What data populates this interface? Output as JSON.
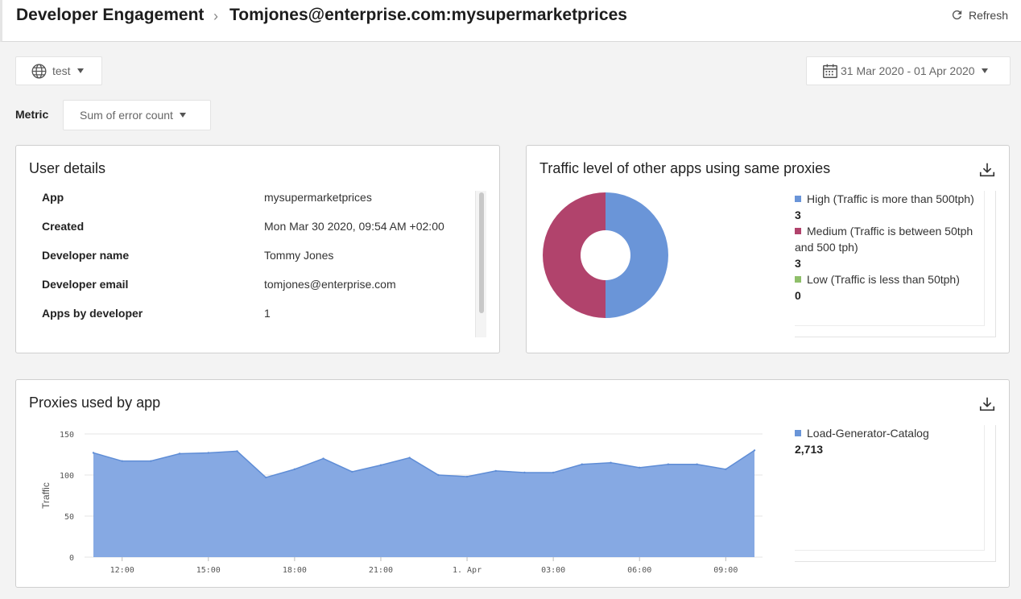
{
  "header": {
    "breadcrumb_root": "Developer Engagement",
    "breadcrumb_current": "Tomjones@enterprise.com:mysupermarketprices",
    "refresh_label": "Refresh"
  },
  "filters": {
    "environment": "test",
    "date_range": "31 Mar 2020 - 01 Apr 2020",
    "metric_label": "Metric",
    "metric_value": "Sum of error count"
  },
  "user_details": {
    "title": "User details",
    "rows": [
      {
        "key": "App",
        "value": "mysupermarketprices"
      },
      {
        "key": "Created",
        "value": "Mon Mar 30 2020, 09:54 AM +02:00"
      },
      {
        "key": "Developer name",
        "value": "Tommy Jones"
      },
      {
        "key": "Developer email",
        "value": "tomjones@enterprise.com"
      },
      {
        "key": "Apps by developer",
        "value": "1"
      }
    ]
  },
  "traffic": {
    "title": "Traffic level of other apps using same proxies",
    "legend": [
      {
        "label": "High (Traffic is more than 500tph)",
        "value": "3",
        "color": "#6a95d8"
      },
      {
        "label": "Medium (Traffic is between 50tph and 500 tph)",
        "value": "3",
        "color": "#b1436c"
      },
      {
        "label": "Low (Traffic is less than 50tph)",
        "value": "0",
        "color": "#8fbf6a"
      }
    ],
    "chart_data": {
      "type": "pie",
      "categories": [
        "High (Traffic is more than 500tph)",
        "Medium (Traffic is between 50tph and 500 tph)",
        "Low (Traffic is less than 50tph)"
      ],
      "values": [
        3,
        3,
        0
      ],
      "colors": [
        "#6a95d8",
        "#b1436c",
        "#8fbf6a"
      ],
      "donut": true
    }
  },
  "proxies": {
    "title": "Proxies used by app",
    "legend": [
      {
        "label": "Load-Generator-Catalog",
        "value": "2,713",
        "color": "#6a95d8"
      }
    ],
    "chart_data": {
      "type": "area",
      "ylabel": "Traffic",
      "ylim": [
        0,
        150
      ],
      "yticks": [
        0,
        50,
        100,
        150
      ],
      "xticks": [
        "12:00",
        "15:00",
        "18:00",
        "21:00",
        "1. Apr",
        "03:00",
        "06:00",
        "09:00"
      ],
      "x": [
        "11:00",
        "12:00",
        "13:00",
        "14:00",
        "15:00",
        "16:00",
        "17:00",
        "18:00",
        "19:00",
        "20:00",
        "21:00",
        "22:00",
        "23:00",
        "00:00",
        "01:00",
        "02:00",
        "03:00",
        "04:00",
        "05:00",
        "06:00",
        "07:00",
        "08:00",
        "09:00",
        "10:00"
      ],
      "series": [
        {
          "name": "Load-Generator-Catalog",
          "color": "#6a95d8",
          "values": [
            127,
            117,
            117,
            126,
            127,
            129,
            97,
            107,
            120,
            104,
            112,
            121,
            100,
            98,
            105,
            103,
            103,
            113,
            115,
            109,
            113,
            113,
            107,
            130
          ]
        }
      ]
    }
  }
}
